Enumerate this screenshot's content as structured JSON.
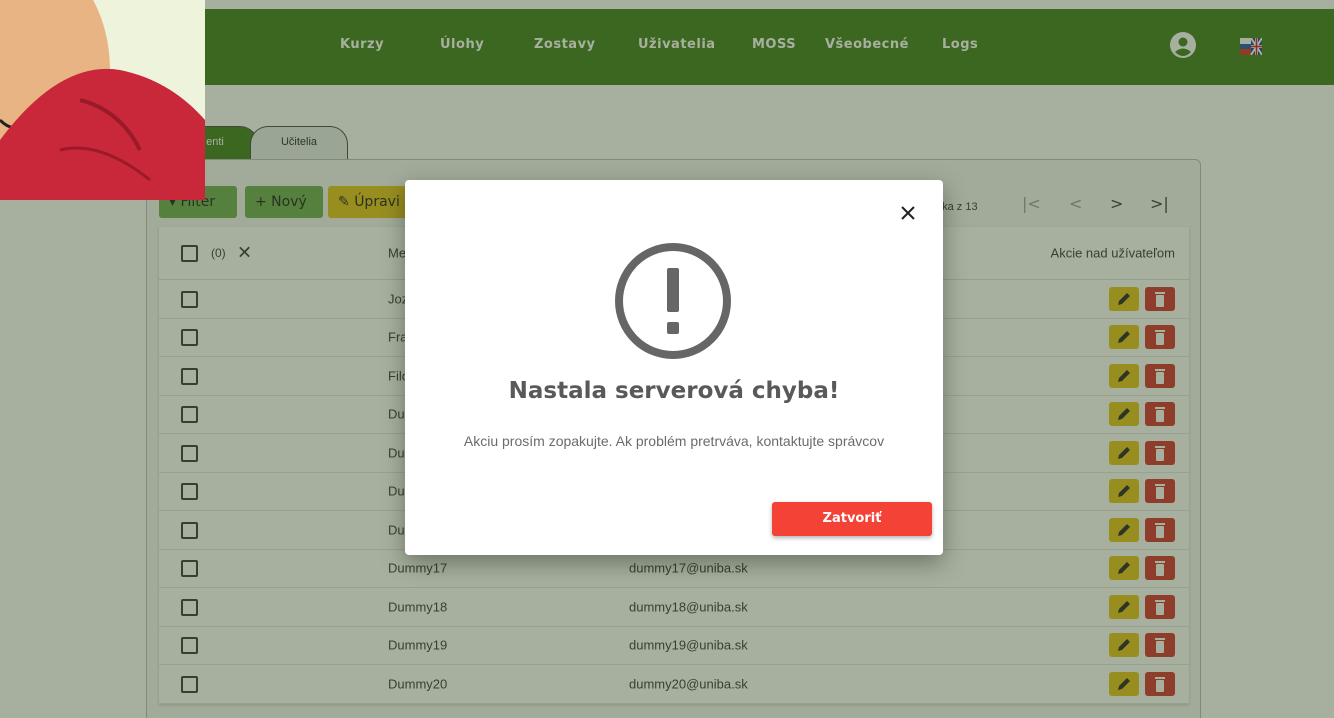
{
  "navbar": {
    "items": [
      {
        "label": "Kurzy"
      },
      {
        "label": "Úlohy"
      },
      {
        "label": "Zostavy"
      },
      {
        "label": "Uživatelia"
      },
      {
        "label": "MOSS"
      },
      {
        "label": "Všeobecné"
      },
      {
        "label": "Logs"
      }
    ],
    "profile_icon": "account-circle-icon",
    "language_icon": "sk-en-flag-icon"
  },
  "tabs": [
    {
      "label": "enti",
      "active": true
    },
    {
      "label": "Učitelia",
      "active": false
    }
  ],
  "toolbar": {
    "filter_label": "Filter",
    "new_label": "+ Nový",
    "edit_label": "Úpravi",
    "pager_text": "nka z 13",
    "first_icon": "|<",
    "prev_icon": "<",
    "next_icon": ">",
    "last_icon": ">|"
  },
  "table": {
    "selected_count": "(0)",
    "header_name": "Me",
    "header_actions": "Akcie nad užívateľom",
    "rows": [
      {
        "name": "Joz",
        "email": ""
      },
      {
        "name": "Fra",
        "email": ""
      },
      {
        "name": "Filo",
        "email": ""
      },
      {
        "name": "Du",
        "email": ""
      },
      {
        "name": "Du",
        "email": ""
      },
      {
        "name": "Du",
        "email": ""
      },
      {
        "name": "Du",
        "email": ""
      },
      {
        "name": "Dummy17",
        "email": "dummy17@uniba.sk"
      },
      {
        "name": "Dummy18",
        "email": "dummy18@uniba.sk"
      },
      {
        "name": "Dummy19",
        "email": "dummy19@uniba.sk"
      },
      {
        "name": "Dummy20",
        "email": "dummy20@uniba.sk"
      }
    ]
  },
  "modal": {
    "title": "Nastala serverová chyba!",
    "message": "Akciu prosím zopakujte. Ak problém pretrváva, kontaktujte správcov",
    "button_label": "Zatvoriť",
    "icon": "exclamation-circle-icon",
    "close_icon": "close-icon"
  },
  "colors": {
    "navbar": "#3c7a1a",
    "edit_button": "#e4c21b",
    "delete_button": "#d32f2f",
    "close_button": "#f44336"
  }
}
